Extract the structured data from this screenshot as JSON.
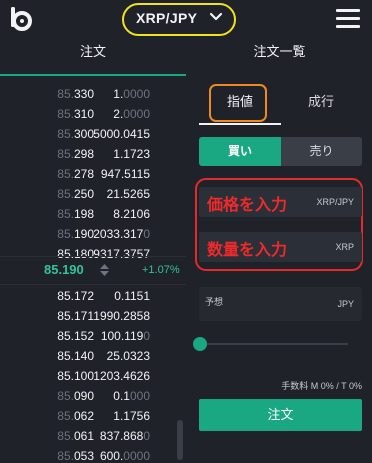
{
  "header": {
    "pair_label": "XRP/JPY",
    "logo_icon": "bitbank-logo-icon",
    "pair_dropdown_icon": "chevron-down-icon",
    "menu_icon": "hamburger-menu-icon",
    "highlight_color": "#f1e21d"
  },
  "tabs": {
    "order": "注文",
    "order_list": "注文一覧",
    "active_color": "#1aa882"
  },
  "orderbook": {
    "asks": [
      {
        "price_dim": "85.",
        "price_main": "330",
        "qty_main": "1.",
        "qty_dim": "0000"
      },
      {
        "price_dim": "85.",
        "price_main": "310",
        "qty_main": "2.",
        "qty_dim": "0000"
      },
      {
        "price_dim": "85.",
        "price_main": "300",
        "qty_main": "5000.0415",
        "qty_dim": ""
      },
      {
        "price_dim": "85.",
        "price_main": "298",
        "qty_main": "1.1723",
        "qty_dim": ""
      },
      {
        "price_dim": "85.",
        "price_main": "278",
        "qty_main": "947.5115",
        "qty_dim": ""
      },
      {
        "price_dim": "85.",
        "price_main": "250",
        "qty_main": "21.5265",
        "qty_dim": ""
      },
      {
        "price_dim": "85.",
        "price_main": "198",
        "qty_main": "8.2106",
        "qty_dim": ""
      },
      {
        "price_dim": "85.",
        "price_main": "190",
        "qty_main": "2033.317",
        "qty_dim": "0"
      },
      {
        "price_dim": "",
        "price_main": "85.180",
        "qty_main": "9317.3757",
        "qty_dim": ""
      }
    ],
    "last_price": "85.190",
    "last_change": "+1.07%",
    "price_arrows_icon": "sort-arrows-icon",
    "bids": [
      {
        "price_dim": "",
        "price_main": "85.172",
        "qty_main": "0.1151",
        "qty_dim": ""
      },
      {
        "price_dim": "",
        "price_main": "85.171",
        "qty_main": "1990.2858",
        "qty_dim": ""
      },
      {
        "price_dim": "",
        "price_main": "85.152",
        "qty_main": "100.119",
        "qty_dim": "0"
      },
      {
        "price_dim": "",
        "price_main": "85.140",
        "qty_main": "25.0323",
        "qty_dim": ""
      },
      {
        "price_dim": "",
        "price_main": "85.100",
        "qty_main": "1203.4626",
        "qty_dim": ""
      },
      {
        "price_dim": "85.",
        "price_main": "090",
        "qty_main": "0.1",
        "qty_dim": "000"
      },
      {
        "price_dim": "85.",
        "price_main": "062",
        "qty_main": "1.1756",
        "qty_dim": ""
      },
      {
        "price_dim": "85.",
        "price_main": "061",
        "qty_main": "837.868",
        "qty_dim": "0"
      },
      {
        "price_dim": "85.",
        "price_main": "053",
        "qty_main": "600.",
        "qty_dim": "0000"
      }
    ],
    "up_color": "#2fc59a"
  },
  "order_form": {
    "type_limit": "指値",
    "type_market": "成行",
    "limit_highlight_color": "#ef8a23",
    "side_buy": "買い",
    "side_sell": "売り",
    "price_placeholder": "価格を入力",
    "price_unit": "XRP/JPY",
    "amount_placeholder": "数量を入力",
    "amount_unit": "XRP",
    "input_highlight_color": "#e52a2a",
    "estimate_label": "予想",
    "estimate_unit": "JPY",
    "slider_value": 0,
    "fee_text": "手数料 M 0% / T 0%",
    "submit_label": "注文"
  }
}
